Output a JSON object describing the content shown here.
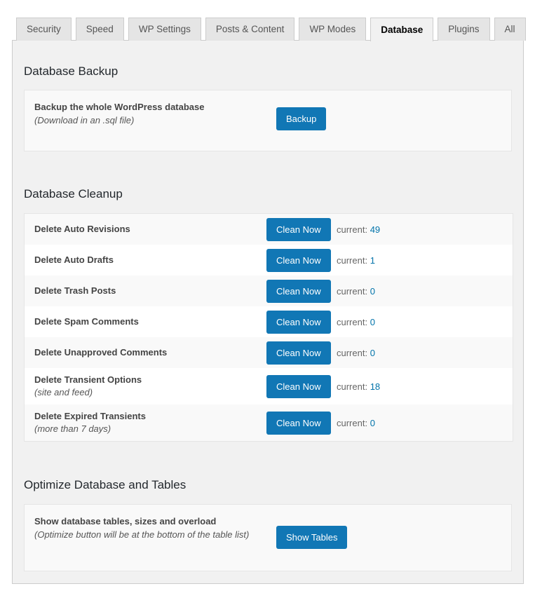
{
  "tabs": [
    {
      "label": "Security",
      "active": false
    },
    {
      "label": "Speed",
      "active": false
    },
    {
      "label": "WP Settings",
      "active": false
    },
    {
      "label": "Posts & Content",
      "active": false
    },
    {
      "label": "WP Modes",
      "active": false
    },
    {
      "label": "Database",
      "active": true
    },
    {
      "label": "Plugins",
      "active": false
    },
    {
      "label": "All",
      "active": false
    }
  ],
  "colors": {
    "button_blue": "#1177b5",
    "value_blue": "#0073aa",
    "panel_bg": "#f1f1f1",
    "card_bg": "#f9f9f9",
    "text_dark": "#23282d"
  },
  "backup": {
    "section_title": "Database Backup",
    "title": "Backup the whole WordPress database",
    "subtitle": "(Download in an .sql file)",
    "button_label": "Backup"
  },
  "cleanup": {
    "section_title": "Database Cleanup",
    "current_label": "current:",
    "button_label": "Clean Now",
    "rows": [
      {
        "title": "Delete Auto Revisions",
        "subtitle": "",
        "button_label": "Clean Now",
        "current_label": "current:",
        "current_value": "49"
      },
      {
        "title": "Delete Auto Drafts",
        "subtitle": "",
        "button_label": "Clean Now",
        "current_label": "current:",
        "current_value": "1"
      },
      {
        "title": "Delete Trash Posts",
        "subtitle": "",
        "button_label": "Clean Now",
        "current_label": "current:",
        "current_value": "0"
      },
      {
        "title": "Delete Spam Comments",
        "subtitle": "",
        "button_label": "Clean Now",
        "current_label": "current:",
        "current_value": "0"
      },
      {
        "title": "Delete Unapproved Comments",
        "subtitle": "",
        "button_label": "Clean Now",
        "current_label": "current:",
        "current_value": "0"
      },
      {
        "title": "Delete Transient Options",
        "subtitle": "(site and feed)",
        "button_label": "Clean Now",
        "current_label": "current:",
        "current_value": "18"
      },
      {
        "title": "Delete Expired Transients",
        "subtitle": "(more than 7 days)",
        "button_label": "Clean Now",
        "current_label": "current:",
        "current_value": "0"
      }
    ]
  },
  "optimize": {
    "section_title": "Optimize Database and Tables",
    "title": "Show database tables, sizes and overload",
    "subtitle": "(Optimize button will be at the bottom of the table list)",
    "button_label": "Show Tables"
  }
}
